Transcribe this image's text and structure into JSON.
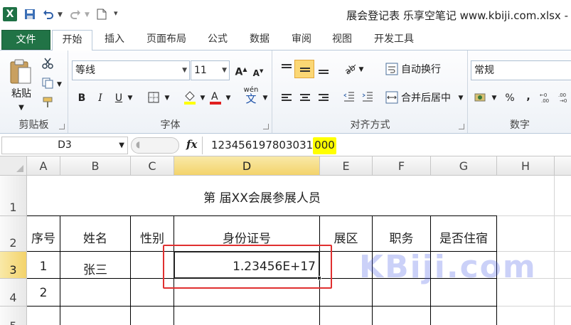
{
  "window": {
    "title": "展会登记表 乐享空笔记 www.kbiji.com.xlsx -",
    "app_icon": "excel-icon"
  },
  "tabs": [
    {
      "label": "文件"
    },
    {
      "label": "开始"
    },
    {
      "label": "插入"
    },
    {
      "label": "页面布局"
    },
    {
      "label": "公式"
    },
    {
      "label": "数据"
    },
    {
      "label": "审阅"
    },
    {
      "label": "视图"
    },
    {
      "label": "开发工具"
    }
  ],
  "ribbon": {
    "clipboard": {
      "label": "剪贴板",
      "paste_label": "粘贴"
    },
    "font": {
      "label": "字体",
      "font_name": "等线",
      "font_size": "11",
      "bold": "B",
      "italic": "I",
      "underline": "U",
      "wen": "wén",
      "wen_char": "文"
    },
    "alignment": {
      "label": "对齐方式",
      "wrap_text": "自动换行",
      "merge_center": "合并后居中"
    },
    "number": {
      "label": "数字",
      "format": "常规",
      "percent": "%",
      "comma": ","
    }
  },
  "formula_bar": {
    "name_box": "D3",
    "fx": "fx",
    "formula_main": "123456197803031",
    "formula_highlight": "000"
  },
  "sheet": {
    "columns": [
      "A",
      "B",
      "C",
      "D",
      "E",
      "F",
      "G",
      "H"
    ],
    "rows": [
      "1",
      "2",
      "3",
      "4",
      "5"
    ],
    "selected_cell": "D3",
    "title": "第  届XX会展参展人员",
    "headers": [
      "序号",
      "姓名",
      "性别",
      "身份证号",
      "展区",
      "职务",
      "是否住宿"
    ],
    "row3": {
      "a": "1",
      "b": "张三",
      "d": "1.23456E+17"
    },
    "row4": {
      "a": "2"
    }
  },
  "watermark": "KBiji.com",
  "colors": {
    "file_tab": "#217346",
    "selection_header": "#f3d36b",
    "highlight": "#ffff00",
    "callout": "#e03030"
  }
}
